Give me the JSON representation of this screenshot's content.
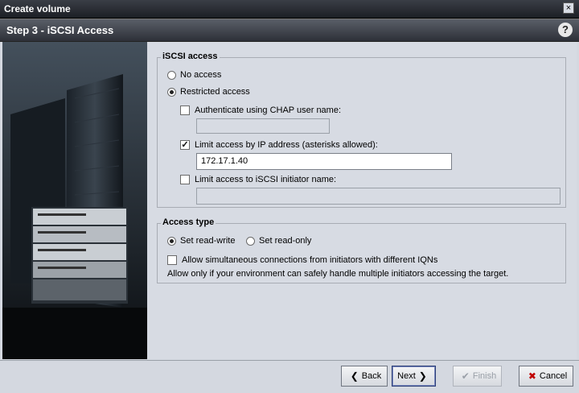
{
  "window": {
    "title": "Create volume",
    "close_glyph": "×"
  },
  "step": {
    "title": "Step 3 - iSCSI Access",
    "help_glyph": "?"
  },
  "iscsi_access": {
    "legend": "iSCSI access",
    "no_access": "No access",
    "restricted_access": "Restricted access",
    "selected": "restricted_access",
    "chap": {
      "label": "Authenticate using CHAP user name:",
      "checked": false,
      "value": ""
    },
    "ip": {
      "label": "Limit access by IP address (asterisks allowed):",
      "checked": true,
      "value": "172.17.1.40"
    },
    "initiator": {
      "label": "Limit access to iSCSI initiator name:",
      "checked": false,
      "value": ""
    }
  },
  "access_type": {
    "legend": "Access type",
    "read_write": "Set read-write",
    "read_only": "Set read-only",
    "selected": "read_write",
    "allow_simultaneous": {
      "label": "Allow simultaneous connections from initiators with different IQNs",
      "checked": false
    },
    "note": "Allow only if your environment can safely handle multiple initiators accessing the target."
  },
  "buttons": {
    "back": "Back",
    "next": "Next",
    "finish": "Finish",
    "cancel": "Cancel"
  }
}
